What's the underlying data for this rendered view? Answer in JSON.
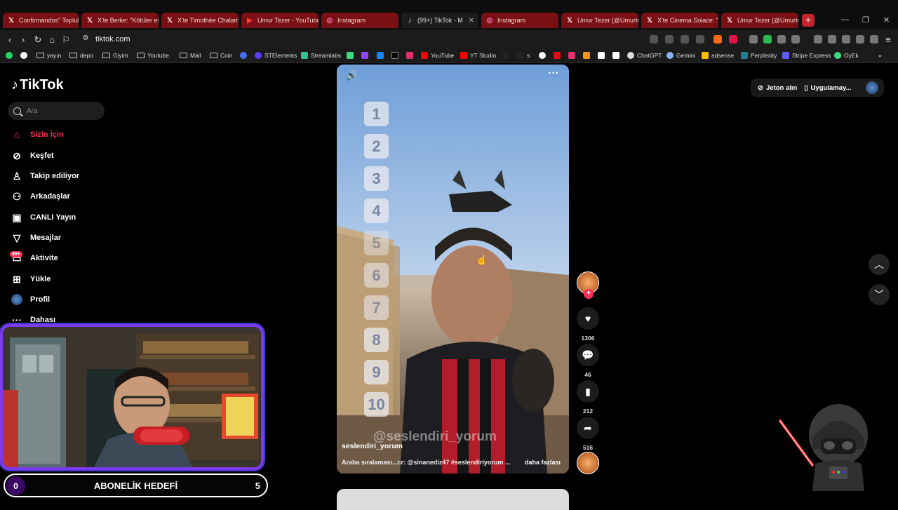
{
  "browser": {
    "tabs": [
      {
        "label": "Confirmandos\" Toplulu",
        "icon": "x-icon"
      },
      {
        "label": "X'te Berke: \"Kötüler esi",
        "icon": "x-icon"
      },
      {
        "label": "X'te Timothée Chalam",
        "icon": "x-icon"
      },
      {
        "label": "Umur Tezer - YouTube",
        "icon": "youtube-icon"
      },
      {
        "label": "Instagram",
        "icon": "instagram-icon"
      },
      {
        "label": "(99+) TikTok - M",
        "icon": "tiktok-icon",
        "active": true
      },
      {
        "label": "Instagram",
        "icon": "instagram-icon"
      },
      {
        "label": "Umur Tezer (@Umurte",
        "icon": "x-icon"
      },
      {
        "label": "X'te Cinema Solace: \"N",
        "icon": "x-icon"
      },
      {
        "label": "Umur Tezer (@Umurte",
        "icon": "x-icon"
      }
    ],
    "url": "tiktok.com",
    "bookmarks": [
      "yayın",
      "depo",
      "Giyim",
      "Youtube",
      "Mail",
      "Coin",
      "STElements",
      "Streamlabs",
      "YouTube",
      "YT Studio",
      "s",
      "ChatGPT",
      "Gemini",
      "adsense",
      "Perplexity",
      "Stripe Express",
      "OyEk"
    ]
  },
  "tiktok": {
    "logo": "TikTok",
    "search_placeholder": "Ara",
    "nav": [
      {
        "label": "Sizin İçin",
        "icon": "home-icon",
        "active": true
      },
      {
        "label": "Keşfet",
        "icon": "compass-icon"
      },
      {
        "label": "Takip ediliyor",
        "icon": "following-icon"
      },
      {
        "label": "Arkadaşlar",
        "icon": "friends-icon"
      },
      {
        "label": "CANLI Yayın",
        "icon": "live-icon"
      },
      {
        "label": "Mesajlar",
        "icon": "messages-icon"
      },
      {
        "label": "Aktivite",
        "icon": "activity-icon"
      },
      {
        "label": "Yükle",
        "icon": "upload-icon"
      },
      {
        "label": "Profil",
        "icon": "profile-icon"
      },
      {
        "label": "Dahası",
        "icon": "more-icon"
      }
    ],
    "activity_badge": "99+",
    "top_right": {
      "coins": "Jeton alın",
      "app": "Uygulamay..."
    },
    "video": {
      "numbers": [
        "1",
        "2",
        "3",
        "4",
        "5",
        "6",
        "7",
        "8",
        "9",
        "10"
      ],
      "author": "seslendiri_yorum",
      "caption": "Araba sıralaması...cr: @sinanediz47 #seslendiriyorum ...",
      "more": "daha fazlası",
      "watermark": "@seslendiri_yorum"
    },
    "actions": {
      "likes": "1306",
      "comments": "46",
      "saves": "212",
      "shares": "516"
    }
  },
  "overlay": {
    "goal_label": "ABONELİK HEDEFİ",
    "goal_current": "0",
    "goal_target": "5"
  }
}
